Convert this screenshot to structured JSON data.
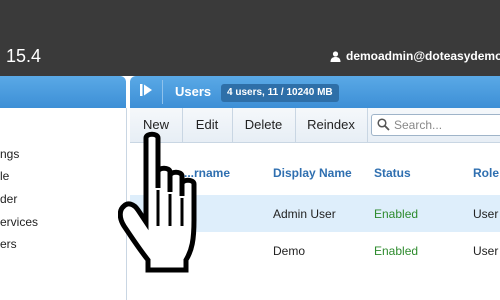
{
  "app": {
    "version": "15.4",
    "username": "demoadmin@doteasydemo.com"
  },
  "sidebar": {
    "items": [
      {
        "label": "ngs"
      },
      {
        "label": "le"
      },
      {
        "label": "der"
      },
      {
        "label": "ervices"
      },
      {
        "label": "ers"
      }
    ]
  },
  "panel": {
    "title": "Users",
    "count_badge": "4 users, 11 / 10240 MB"
  },
  "toolbar": {
    "new_label": "New",
    "edit_label": "Edit",
    "delete_label": "Delete",
    "reindex_label": "Reindex"
  },
  "search": {
    "placeholder": "Search..."
  },
  "table": {
    "columns": [
      "...rname",
      "Display Name",
      "Status",
      "Role"
    ],
    "rows": [
      {
        "display_name": "Admin User",
        "status": "Enabled",
        "role": "User"
      },
      {
        "display_name": "Demo",
        "status": "Enabled",
        "role": "User"
      }
    ]
  },
  "colors": {
    "accent_blue": "#3d8fd6",
    "status_enabled": "#2e8b2e",
    "header_text": "#2f6fb0",
    "topbar": "#3a3a3a"
  }
}
